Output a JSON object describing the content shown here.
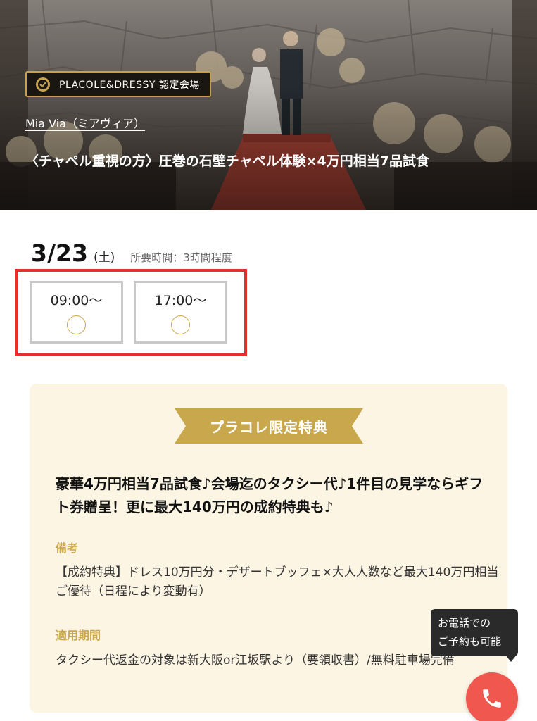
{
  "hero": {
    "badge_label": "PLACOLE&DRESSY 認定会場",
    "venue_name": "Mia Via（ミアヴィア）",
    "plan_title": "〈チャペル重視の方〉圧巻の石壁チャペル体験×4万円相当7品試食"
  },
  "schedule": {
    "date": "3/23",
    "day_of_week": "(土)",
    "duration": "所要時間：3時間程度",
    "slots": [
      {
        "time": "09:00〜",
        "availability": "◯"
      },
      {
        "time": "17:00〜",
        "availability": "◯"
      }
    ]
  },
  "benefit": {
    "ribbon_label": "プラコレ限定特典",
    "headline": "豪華4万円相当7品試食♪会場迄のタクシー代♪1件目の見学ならギフト券贈呈！更に最大140万円の成約特典も♪",
    "notes_label": "備考",
    "notes_body": "【成約特典】ドレス10万円分・デザートブッフェ×大人人数など最大140万円相当ご優待（日程により変動有）",
    "period_label": "適用期間",
    "period_body": "タクシー代返金の対象は新大阪or江坂駅より（要領収書）/無料駐車場完備"
  },
  "call": {
    "tooltip_line1": "お電話での",
    "tooltip_line2": "ご予約も可能",
    "icon": "phone-icon"
  },
  "colors": {
    "highlight_red": "#e5302f",
    "gold": "#c9a84d",
    "card_bg": "#fdf5e4",
    "call_button": "#f0574f"
  }
}
